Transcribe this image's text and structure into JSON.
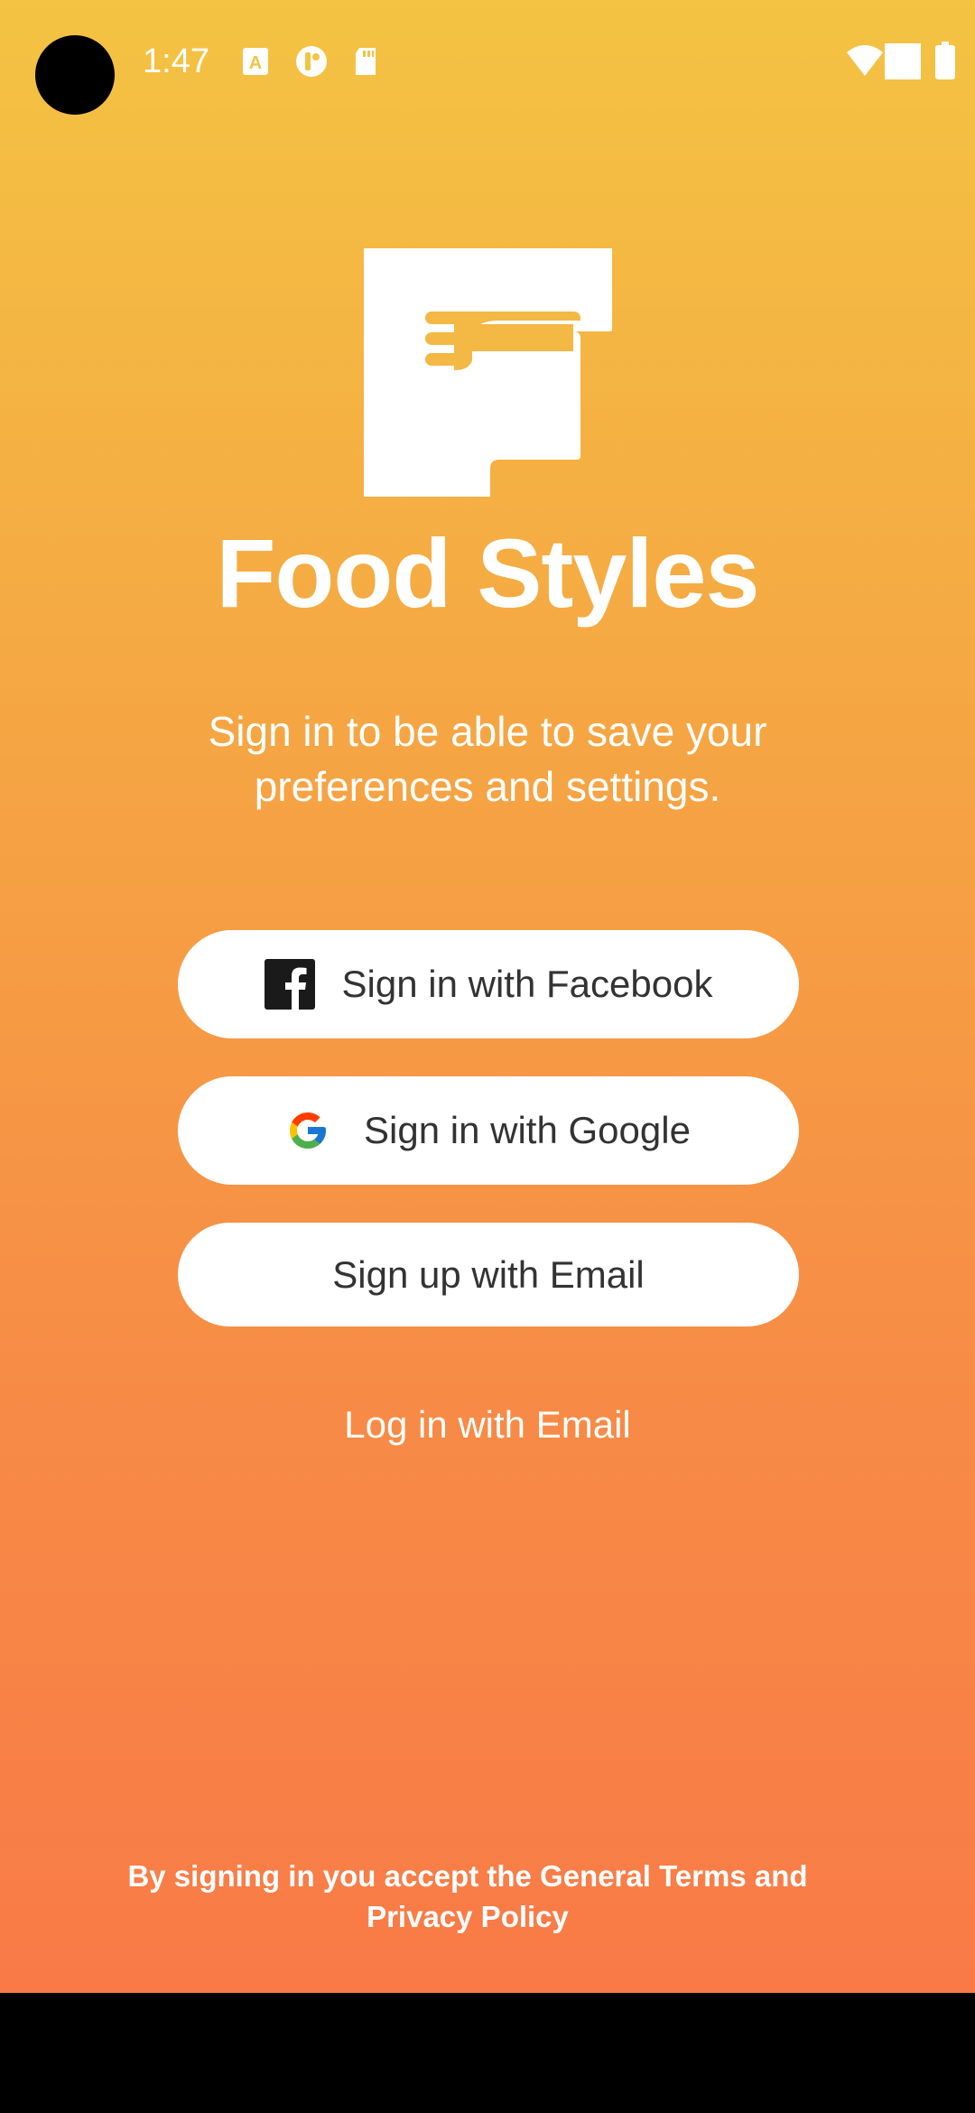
{
  "status_bar": {
    "time": "1:47"
  },
  "app": {
    "title": "Food Styles",
    "subtitle": "Sign in to be able to save your preferences and settings."
  },
  "buttons": {
    "facebook": "Sign in with Facebook",
    "google": "Sign in with Google",
    "email_signup": "Sign up with Email"
  },
  "login_link": "Log in with Email",
  "terms": "By signing in you accept the General Terms and Privacy Policy",
  "icons": {
    "facebook": "facebook-icon",
    "google": "google-icon",
    "logo": "food-styles-logo"
  },
  "colors": {
    "gradient_top": "#f4c343",
    "gradient_bottom": "#f97a47",
    "button_text": "#333333"
  }
}
